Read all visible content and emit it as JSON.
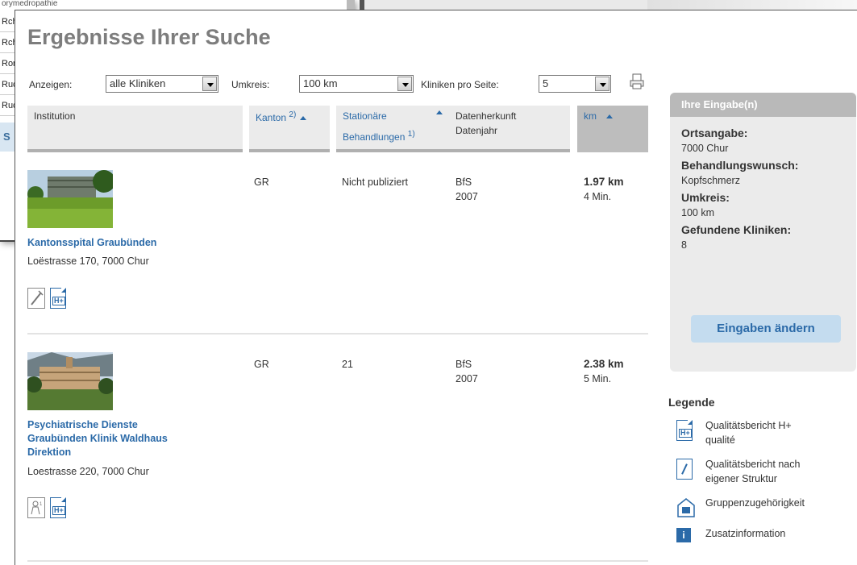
{
  "background_window": {
    "top_text": "orymedropathie",
    "rows": [
      "Rch",
      "Rch",
      "Rom",
      "Ruc",
      "Ruc"
    ],
    "button_label": "S"
  },
  "page_title": "Ergebnisse Ihrer Suche",
  "controls": {
    "show_label": "Anzeigen:",
    "show_value": "alle Kliniken",
    "radius_label": "Umkreis:",
    "radius_value": "100 km",
    "per_page_label": "Kliniken pro Seite:",
    "per_page_value": "5"
  },
  "table": {
    "headers": {
      "institution": "Institution",
      "kanton": "Kanton",
      "kanton_note": "2)",
      "stationaer_line1": "Stationäre",
      "stationaer_line2": "Behandlungen",
      "stationaer_note": "1)",
      "herkunft_line1": "Datenherkunft",
      "herkunft_line2": "Datenjahr",
      "km": "km"
    },
    "rows": [
      {
        "name": "Kantonsspital Graubünden",
        "address": "Loëstrasse 170, 7000 Chur",
        "kanton": "GR",
        "stationaer": "Nicht publiziert",
        "herkunft": "BfS",
        "jahr": "2007",
        "km": "1.97 km",
        "time": "4 Min."
      },
      {
        "name_line1": "Psychiatrische Dienste",
        "name_line2": "Graubünden Klinik Waldhaus",
        "name_line3": "Direktion",
        "address": "Loestrasse 220, 7000 Chur",
        "kanton": "GR",
        "stationaer": "21",
        "herkunft": "BfS",
        "jahr": "2007",
        "km": "2.38 km",
        "time": "5 Min."
      }
    ]
  },
  "sidebar": {
    "title": "Ihre Eingabe(n)",
    "ort_label": "Ortsangabe:",
    "ort_value": "7000 Chur",
    "wunsch_label": "Behandlungswunsch:",
    "wunsch_value": "Kopfschmerz",
    "umkreis_label": "Umkreis:",
    "umkreis_value": "100 km",
    "gefunden_label": "Gefundene Kliniken:",
    "gefunden_value": "8",
    "button": "Eingaben ändern"
  },
  "legend": {
    "title": "Legende",
    "items": [
      {
        "line1": "Qualitätsbericht H+",
        "line2": "qualité"
      },
      {
        "line1": "Qualitätsbericht nach",
        "line2": "eigener Struktur"
      },
      {
        "line1": "Gruppenzugehörigkeit",
        "line2": ""
      },
      {
        "line1": "Zusatzinformation",
        "line2": ""
      }
    ]
  },
  "colors": {
    "link_blue": "#2b6aa8",
    "title_gray": "#7d7d7d",
    "sidebar_bg": "#ebebeb",
    "button_bg": "#c4dcef"
  },
  "icons": [
    "print-icon",
    "syringe-icon",
    "h-plus-report-icon",
    "patient-icon",
    "doc-pen-icon",
    "building-icon",
    "info-icon"
  ]
}
